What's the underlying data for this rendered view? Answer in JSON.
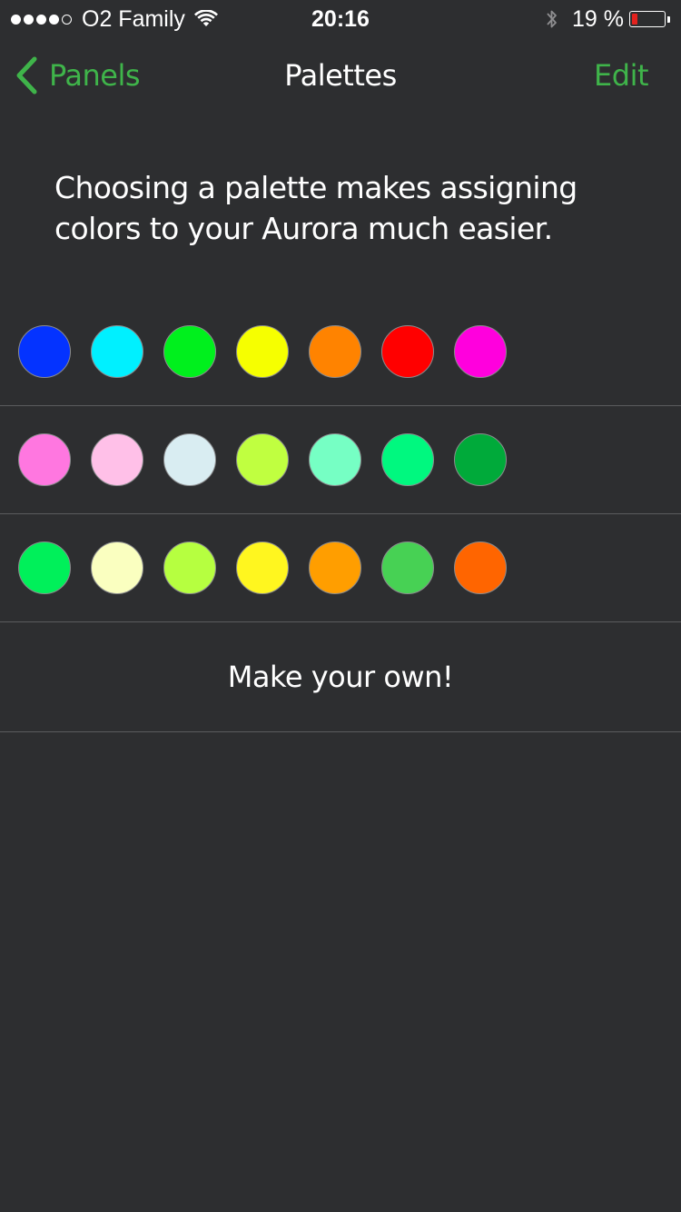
{
  "status_bar": {
    "signal_bars": 4,
    "signal_total": 5,
    "carrier": "O2 Family",
    "time": "20:16",
    "battery_percent": "19 %",
    "battery_level": 0.19,
    "battery_color": "#e3221e"
  },
  "nav": {
    "back_label": "Panels",
    "title": "Palettes",
    "edit_label": "Edit",
    "accent_color": "#3fb44a"
  },
  "intro_text": "Choosing a palette makes assigning colors to your Aurora much easier.",
  "palettes": [
    {
      "colors": [
        "#0433ff",
        "#00f0ff",
        "#00f01d",
        "#f6ff00",
        "#ff8300",
        "#ff0000",
        "#ff00dd"
      ]
    },
    {
      "colors": [
        "#ff77e0",
        "#ffc0e8",
        "#d9edf2",
        "#c0ff40",
        "#76ffc4",
        "#00f87f",
        "#00aa3a"
      ]
    },
    {
      "colors": [
        "#00f05a",
        "#faffc0",
        "#b6ff40",
        "#fff61f",
        "#ff9e00",
        "#47d154",
        "#ff6500"
      ]
    }
  ],
  "make_own_label": "Make your own!"
}
